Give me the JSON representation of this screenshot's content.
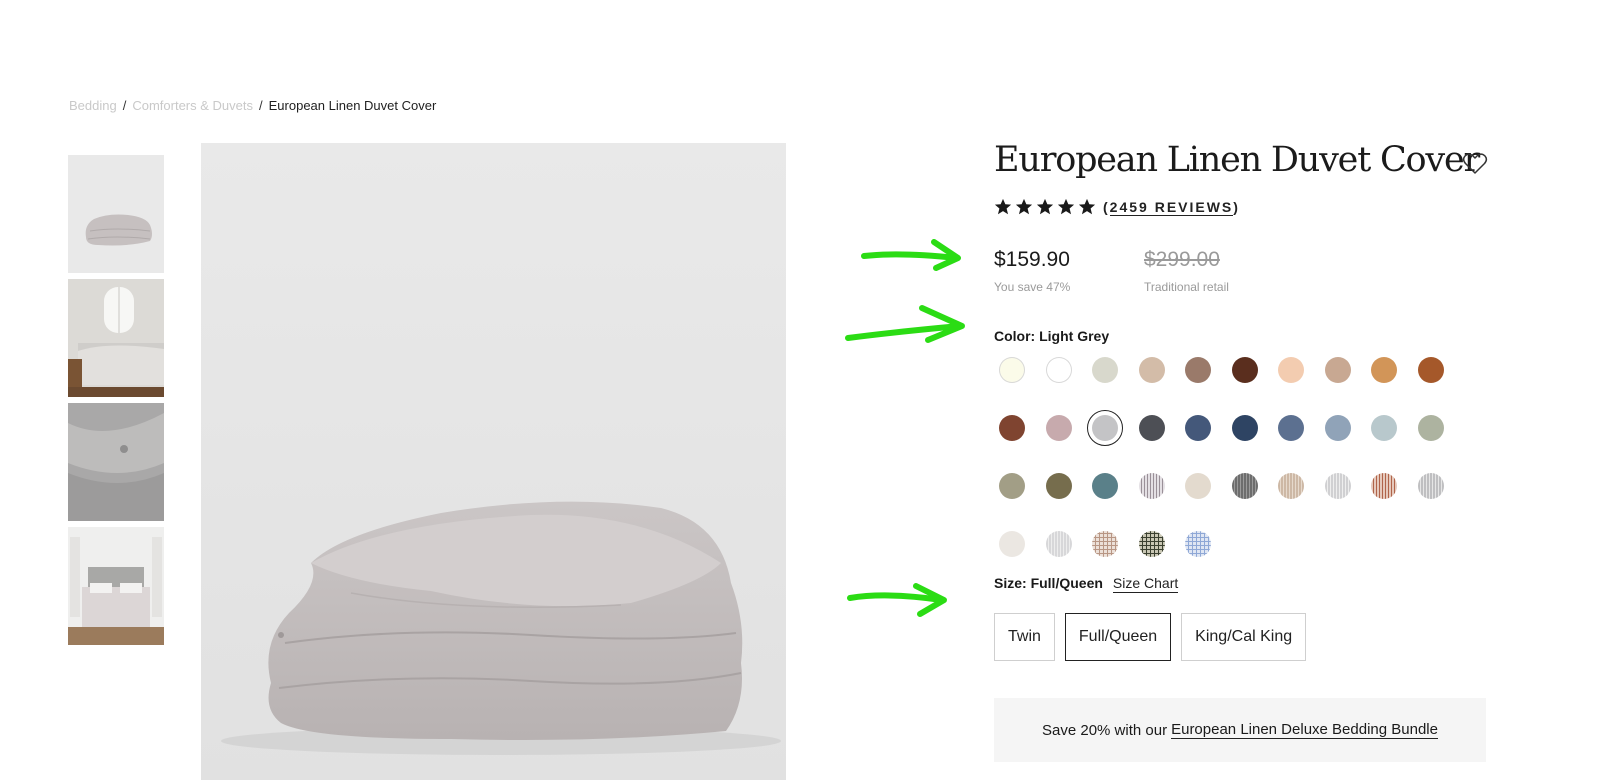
{
  "breadcrumb": {
    "items": [
      "Bedding",
      "Comforters & Duvets"
    ],
    "separator": "/",
    "current": "European Linen Duvet Cover"
  },
  "product": {
    "title": "European Linen Duvet Cover",
    "rating_stars": 5,
    "reviews_open": "(",
    "reviews_text": "2459 REVIEWS",
    "reviews_close": ")",
    "price": "$159.90",
    "savings": "You save 47%",
    "original_price": "$299.00",
    "original_label": "Traditional retail",
    "color_label": "Color: Light Grey",
    "size_label": "Size: Full/Queen",
    "size_chart": "Size Chart",
    "sizes": [
      "Twin",
      "Full/Queen",
      "King/Cal King"
    ],
    "selected_size": "Full/Queen",
    "bundle_text": "Save 20% with our",
    "bundle_link": "European Linen Deluxe Bedding Bundle"
  },
  "swatches": [
    {
      "color": "#fbfbe9",
      "outline": true
    },
    {
      "color": "#ffffff",
      "outline": true
    },
    {
      "color": "#d8d8cc"
    },
    {
      "color": "#d3bca8"
    },
    {
      "color": "#9a7a6a"
    },
    {
      "color": "#5a2e1e"
    },
    {
      "color": "#f3ccb0"
    },
    {
      "color": "#c8a892"
    },
    {
      "color": "#d29558"
    },
    {
      "color": "#a5582a"
    },
    {
      "color": "#7f4430"
    },
    {
      "color": "#c7aaad"
    },
    {
      "color": "#c4c4c6",
      "selected": true
    },
    {
      "color": "#4d4f55"
    },
    {
      "color": "#44587a"
    },
    {
      "color": "#2e4463"
    },
    {
      "color": "#5c7090"
    },
    {
      "color": "#90a3b8"
    },
    {
      "color": "#b8c8cc"
    },
    {
      "color": "#adb3a0"
    },
    {
      "color": "#a29e86"
    },
    {
      "color": "#766d4d"
    },
    {
      "color": "#5a8089"
    },
    {
      "color": "#e4e0e4",
      "pattern": "stripe",
      "stripe": "#9a9098"
    },
    {
      "color": "#e3dace"
    },
    {
      "color": "#6d6d6d",
      "pattern": "stripe",
      "stripe": "#9a9a9a"
    },
    {
      "color": "#cdb8a5",
      "pattern": "stripe",
      "stripe": "#e6d9cc"
    },
    {
      "color": "#d0d0d2",
      "pattern": "stripe",
      "stripe": "#eeeeee"
    },
    {
      "color": "#e5c9bc",
      "pattern": "stripe",
      "stripe": "#b0644a"
    },
    {
      "color": "#bfbfc1",
      "pattern": "stripe",
      "stripe": "#e6e6e6"
    },
    {
      "color": "#ebe7e2"
    },
    {
      "color": "#d7d7d9",
      "pattern": "stripe",
      "stripe": "#ededed"
    },
    {
      "color": "#ece0d8",
      "pattern": "check",
      "stripe": "#b89684"
    },
    {
      "color": "#c9c7b4",
      "pattern": "check",
      "stripe": "#3b4030"
    },
    {
      "color": "#dfe6f3",
      "pattern": "check",
      "stripe": "#8fa8d6"
    }
  ],
  "thumbnails": [
    {
      "name": "thumbnail-folded-duvet"
    },
    {
      "name": "thumbnail-bedroom-window"
    },
    {
      "name": "thumbnail-linen-closeup"
    },
    {
      "name": "thumbnail-bed-front"
    }
  ],
  "colors": {
    "annotation_arrow": "#2bdc14",
    "text_dark": "#1a1a1a",
    "muted": "#9a9a9a"
  }
}
